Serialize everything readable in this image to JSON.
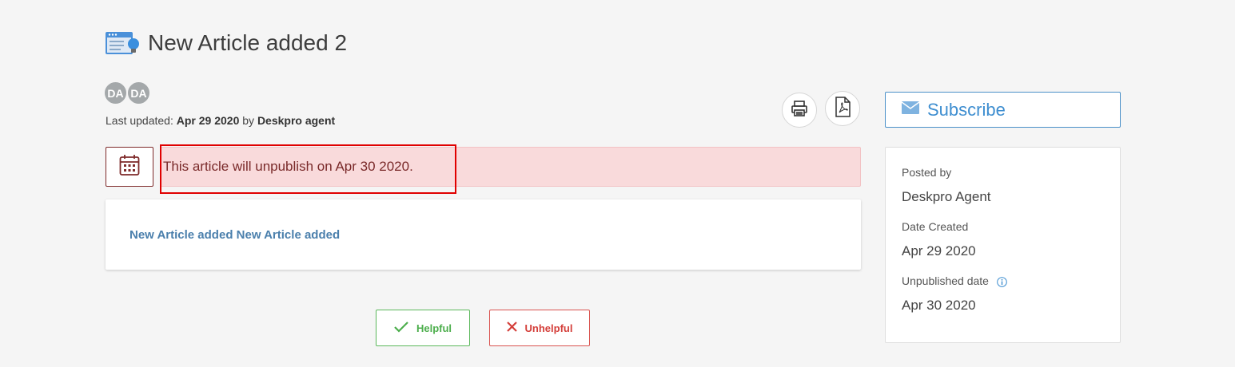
{
  "article": {
    "title": "New Article added 2",
    "icon": "article-bulb-icon"
  },
  "authors": [
    {
      "initials": "DA"
    },
    {
      "initials": "DA"
    }
  ],
  "meta": {
    "last_updated_label": "Last updated:",
    "last_updated_date": "Apr 29 2020",
    "by_label": "by",
    "author_name": "Deskpro agent"
  },
  "actions": {
    "print_icon": "printer-icon",
    "pdf_icon": "pdf-icon"
  },
  "subscribe": {
    "label": "Subscribe",
    "icon": "envelope-icon"
  },
  "notice": {
    "icon": "calendar-icon",
    "text": "This article will unpublish on Apr 30 2020."
  },
  "content": {
    "link_text": "New Article added New Article added"
  },
  "feedback": {
    "helpful_label": "Helpful",
    "unhelpful_label": "Unhelpful"
  },
  "info": {
    "posted_by_label": "Posted by",
    "posted_by_value": "Deskpro Agent",
    "date_created_label": "Date Created",
    "date_created_value": "Apr 29 2020",
    "unpublished_label": "Unpublished date",
    "unpublished_value": "Apr 30 2020"
  },
  "colors": {
    "accent": "#3e8ed0",
    "notice_bg": "#f9dadb",
    "notice_text": "#7a2a2a",
    "helpful": "#5cb85c",
    "unhelpful": "#d9534f",
    "highlight": "#e00000"
  }
}
